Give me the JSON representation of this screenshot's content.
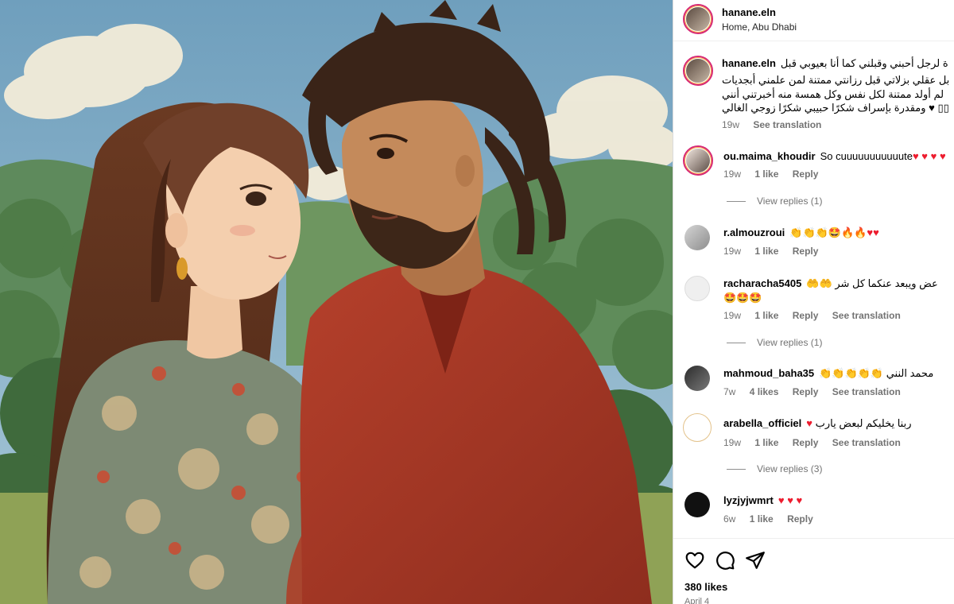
{
  "post": {
    "author": "hanane.eln",
    "location": "Home, Abu Dhabi",
    "caption_lines": [
      "ة لرجل أحبني وقبلني كما أنا بعيوبي قبل",
      "بل عقلي بزلاتي قبل رزانتي ممتنة لمن علمني أبجديات",
      "لم أولد ممتنة لكل نفس وكل همسة منه أخبرتني أنني",
      "ومقدرة بإسراف شكرًا حبيبي شكرًا زوجي الغالي ♥ ▯▯"
    ],
    "caption_time": "19w",
    "caption_translate": "See translation"
  },
  "comments": [
    {
      "user": "ou.maima_khoudir",
      "text": "So cuuuuuuuuuuute",
      "emoji": "♥ ♥ ♥ ♥",
      "time": "19w",
      "likes": "1 like",
      "reply": "Reply",
      "translate": ""
    },
    {
      "user": "r.almouzroui",
      "text": "",
      "emoji": "👏👏👏🤩🔥🔥♥♥",
      "time": "19w",
      "likes": "1 like",
      "reply": "Reply",
      "translate": ""
    },
    {
      "user": "racharacha5405",
      "text": "عض ويبعد عنكما كل شر",
      "emoji": "🤲🤲",
      "emoji2": "🤩🤩🤩",
      "time": "19w",
      "likes": "1 like",
      "reply": "Reply",
      "translate": "See translation"
    },
    {
      "user": "mahmoud_baha35",
      "text": "محمد النني",
      "emoji": "👏👏👏👏👏",
      "time": "7w",
      "likes": "4 likes",
      "reply": "Reply",
      "translate": "See translation"
    },
    {
      "user": "arabella_officiel",
      "text": "ربنا يخليكم لبعض يارب",
      "emoji": "♥",
      "time": "19w",
      "likes": "1 like",
      "reply": "Reply",
      "translate": "See translation"
    },
    {
      "user": "lyzjyjwmrt",
      "text": "",
      "emoji": "♥ ♥ ♥",
      "time": "6w",
      "likes": "1 like",
      "reply": "Reply",
      "translate": ""
    }
  ],
  "view_replies": [
    "View replies (1)",
    "View replies (1)",
    "View replies (3)"
  ],
  "actions": {
    "like_icon": "heart-outline-icon",
    "comment_icon": "comment-bubble-icon",
    "share_icon": "paper-plane-icon"
  },
  "likes": "380 likes",
  "date": "April 4",
  "colors": {
    "heart": "#ed1c2e",
    "story_ring": "#d62976",
    "muted": "#737373"
  }
}
